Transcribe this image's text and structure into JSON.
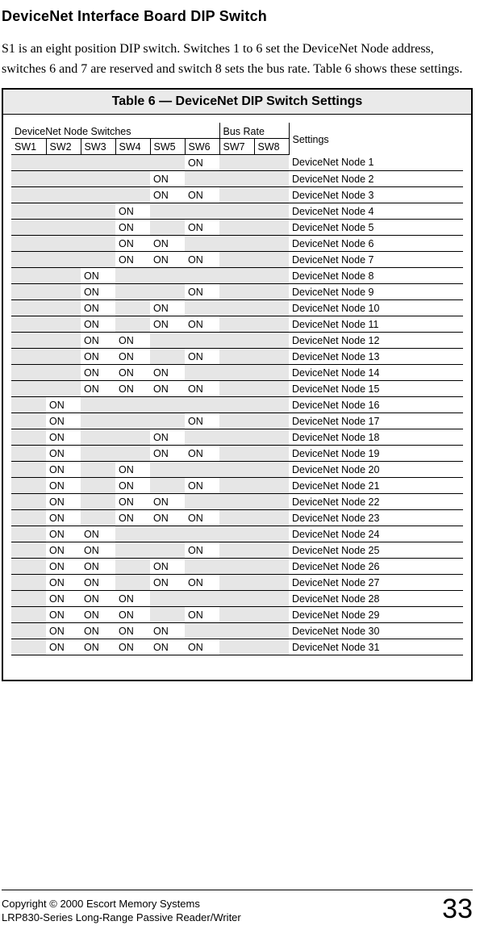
{
  "heading": "DeviceNet Interface Board DIP Switch",
  "intro": "S1 is an eight position DIP switch. Switches 1 to 6 set the DeviceNet Node address, switches 6 and 7 are reserved and switch 8 sets the bus rate. Table 6 shows these settings.",
  "table_title": "Table 6  — DeviceNet DIP Switch Settings",
  "group_node": "DeviceNet Node Switches",
  "group_bus": "Bus Rate",
  "settings_label": "Settings",
  "sw_headers": [
    "SW1",
    "SW2",
    "SW3",
    "SW4",
    "SW5",
    "SW6",
    "SW7",
    "SW8"
  ],
  "on_label": "ON",
  "rows": [
    {
      "sw": [
        "",
        "",
        "",
        "",
        "",
        "ON",
        "",
        ""
      ],
      "name": "DeviceNet Node 1"
    },
    {
      "sw": [
        "",
        "",
        "",
        "",
        "ON",
        "",
        "",
        ""
      ],
      "name": "DeviceNet Node 2"
    },
    {
      "sw": [
        "",
        "",
        "",
        "",
        "ON",
        "ON",
        "",
        ""
      ],
      "name": "DeviceNet Node 3"
    },
    {
      "sw": [
        "",
        "",
        "",
        "ON",
        "",
        "",
        "",
        ""
      ],
      "name": "DeviceNet Node 4"
    },
    {
      "sw": [
        "",
        "",
        "",
        "ON",
        "",
        "ON",
        "",
        ""
      ],
      "name": "DeviceNet Node 5"
    },
    {
      "sw": [
        "",
        "",
        "",
        "ON",
        "ON",
        "",
        "",
        ""
      ],
      "name": "DeviceNet Node 6"
    },
    {
      "sw": [
        "",
        "",
        "",
        "ON",
        "ON",
        "ON",
        "",
        ""
      ],
      "name": "DeviceNet Node 7"
    },
    {
      "sw": [
        "",
        "",
        "ON",
        "",
        "",
        "",
        "",
        ""
      ],
      "name": "DeviceNet Node 8"
    },
    {
      "sw": [
        "",
        "",
        "ON",
        "",
        "",
        "ON",
        "",
        ""
      ],
      "name": "DeviceNet Node 9"
    },
    {
      "sw": [
        "",
        "",
        "ON",
        "",
        "ON",
        "",
        "",
        ""
      ],
      "name": "DeviceNet Node 10"
    },
    {
      "sw": [
        "",
        "",
        "ON",
        "",
        "ON",
        "ON",
        "",
        ""
      ],
      "name": "DeviceNet Node 11"
    },
    {
      "sw": [
        "",
        "",
        "ON",
        "ON",
        "",
        "",
        "",
        ""
      ],
      "name": "DeviceNet Node 12"
    },
    {
      "sw": [
        "",
        "",
        "ON",
        "ON",
        "",
        "ON",
        "",
        ""
      ],
      "name": "DeviceNet Node 13"
    },
    {
      "sw": [
        "",
        "",
        "ON",
        "ON",
        "ON",
        "",
        "",
        ""
      ],
      "name": "DeviceNet Node 14"
    },
    {
      "sw": [
        "",
        "",
        "ON",
        "ON",
        "ON",
        "ON",
        "",
        ""
      ],
      "name": "DeviceNet Node 15"
    },
    {
      "sw": [
        "",
        "ON",
        "",
        "",
        "",
        "",
        "",
        ""
      ],
      "name": "DeviceNet Node 16"
    },
    {
      "sw": [
        "",
        "ON",
        "",
        "",
        "",
        "ON",
        "",
        ""
      ],
      "name": "DeviceNet Node 17"
    },
    {
      "sw": [
        "",
        "ON",
        "",
        "",
        "ON",
        "",
        "",
        ""
      ],
      "name": "DeviceNet Node 18"
    },
    {
      "sw": [
        "",
        "ON",
        "",
        "",
        "ON",
        "ON",
        "",
        ""
      ],
      "name": "DeviceNet Node 19"
    },
    {
      "sw": [
        "",
        "ON",
        "",
        "ON",
        "",
        "",
        "",
        ""
      ],
      "name": "DeviceNet Node 20"
    },
    {
      "sw": [
        "",
        "ON",
        "",
        "ON",
        "",
        "ON",
        "",
        ""
      ],
      "name": "DeviceNet Node 21"
    },
    {
      "sw": [
        "",
        "ON",
        "",
        "ON",
        "ON",
        "",
        "",
        ""
      ],
      "name": "DeviceNet Node 22"
    },
    {
      "sw": [
        "",
        "ON",
        "",
        "ON",
        "ON",
        "ON",
        "",
        ""
      ],
      "name": "DeviceNet Node 23"
    },
    {
      "sw": [
        "",
        "ON",
        "ON",
        "",
        "",
        "",
        "",
        ""
      ],
      "name": "DeviceNet Node 24"
    },
    {
      "sw": [
        "",
        "ON",
        "ON",
        "",
        "",
        "ON",
        "",
        ""
      ],
      "name": "DeviceNet Node 25"
    },
    {
      "sw": [
        "",
        "ON",
        "ON",
        "",
        "ON",
        "",
        "",
        ""
      ],
      "name": "DeviceNet Node 26"
    },
    {
      "sw": [
        "",
        "ON",
        "ON",
        "",
        "ON",
        "ON",
        "",
        ""
      ],
      "name": "DeviceNet Node 27"
    },
    {
      "sw": [
        "",
        "ON",
        "ON",
        "ON",
        "",
        "",
        "",
        ""
      ],
      "name": "DeviceNet Node 28"
    },
    {
      "sw": [
        "",
        "ON",
        "ON",
        "ON",
        "",
        "ON",
        "",
        ""
      ],
      "name": "DeviceNet Node 29"
    },
    {
      "sw": [
        "",
        "ON",
        "ON",
        "ON",
        "ON",
        "",
        "",
        ""
      ],
      "name": "DeviceNet Node 30"
    },
    {
      "sw": [
        "",
        "ON",
        "ON",
        "ON",
        "ON",
        "ON",
        "",
        ""
      ],
      "name": "DeviceNet Node 31"
    }
  ],
  "footer_line1": "Copyright © 2000 Escort Memory Systems",
  "footer_line2": "LRP830-Series Long-Range Passive Reader/Writer",
  "page_number": "33"
}
